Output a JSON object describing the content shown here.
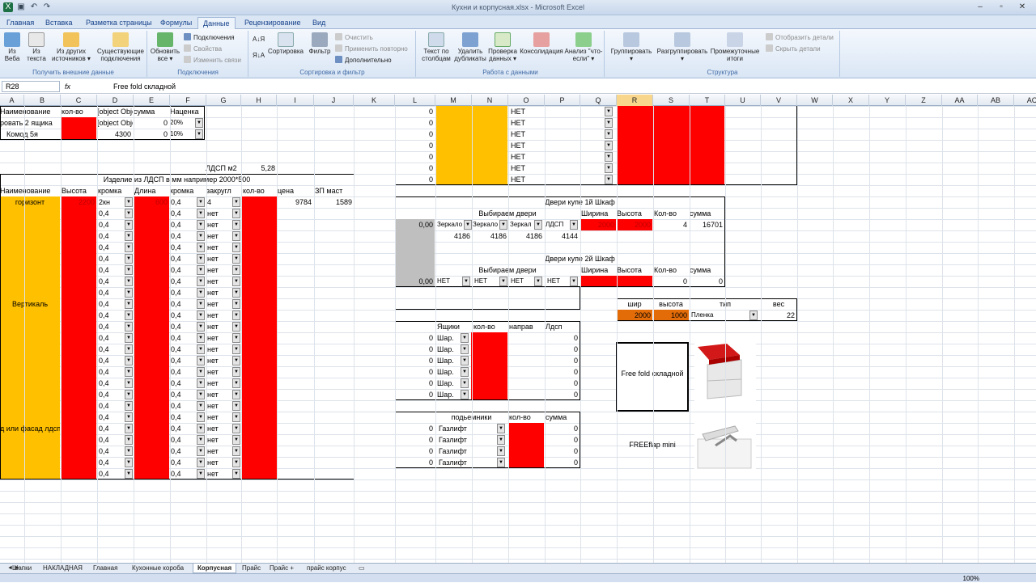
{
  "window": {
    "title": "Кухни и корпусная.xlsx - Microsoft Excel"
  },
  "tabs": [
    "Главная",
    "Вставка",
    "Разметка страницы",
    "Формулы",
    "Данные",
    "Рецензирование",
    "Вид"
  ],
  "ribbon": {
    "g1": {
      "label": "Получить внешние данные",
      "b1": "Из Веба",
      "b2": "Из текста",
      "b3": "Из других источников ▾",
      "b4": "Существующие подключения"
    },
    "g2": {
      "label": "Подключения",
      "b1": "Обновить все ▾",
      "s1": "Подключения",
      "s2": "Свойства",
      "s3": "Изменить связи"
    },
    "g3": {
      "label": "Сортировка и фильтр",
      "b1": "Сортировка",
      "b2": "Фильтр",
      "s1": "Очистить",
      "s2": "Применить повторно",
      "s3": "Дополнительно"
    },
    "g4": {
      "label": "Работа с данными",
      "b1": "Текст по столбцам",
      "b2": "Удалить дубликаты",
      "b3": "Проверка данных ▾",
      "b4": "Консолидация",
      "b5": "Анализ \"что-если\" ▾"
    },
    "g5": {
      "label": "Структура",
      "b1": "Группировать ▾",
      "b2": "Разгруппировать ▾",
      "b3": "Промежуточные итоги",
      "s1": "Отобразить детали",
      "s2": "Скрыть детали"
    }
  },
  "formula": {
    "cell": "R28",
    "fx": "fx",
    "value": "Free fold складной"
  },
  "sheet": {
    "a1": "Наименование",
    "c1": "кол-во",
    "d1": {
      "l": "0,00",
      "m": "Зеркало",
      "n": "Зеркало",
      "o": "Зеркал",
      "p": "ЛДСП",
      "q": "2000",
      "r": "2000",
      "s": "4",
      "t": "16701"
    },
    "e1": "сумма",
    "f1": "Наценка",
    "a2": "ровать 2 ящика",
    "d2": {
      "l": "0,00",
      "m": "НЕТ",
      "n": "НЕТ",
      "o": "НЕТ",
      "p": "НЕТ",
      "s": "0",
      "t": "0"
    },
    "e2": "0",
    "f2": "20%",
    "a3": "Комод 5я",
    "d3": "4300",
    "e3": "0",
    "f3": "10%",
    "g6": "ЛДСП м2",
    "h6": "5,28",
    "t7": "Изделие из ЛДСП в мм например 2000*500",
    "h8": [
      "Наименование",
      "Высота",
      "кромка",
      "Длина",
      "кромка",
      "закругл",
      "кол-во",
      "цена",
      "ЗП маст"
    ],
    "r9": {
      "a": "горизонт",
      "c": "2200",
      "d": "2кн",
      "e": "600",
      "f": "0,4",
      "g": "4",
      "i": "9784",
      "j": "1589"
    },
    "kr": "0,4",
    "zk": "нет",
    "vert": "Вертикаль",
    "fasad": "д или фасад лдсп",
    "net": "НЕТ",
    "doors1": "Двери купе 1й Шкаф",
    "vybir": "Выбираем двери",
    "dh": [
      "Ширина",
      "Высота",
      "Кол-во",
      "сумма"
    ],
    "d1b": [
      "4186",
      "4186",
      "4186",
      "4144"
    ],
    "doors2": "Двери купе 2й Шкаф",
    "w": {
      "h1": "шир",
      "h2": "высота",
      "h3": "тип",
      "h4": "вес",
      "v1": "2000",
      "v2": "1000",
      "v3": "Пленка",
      "v4": "22"
    },
    "yash": [
      "Ящики",
      "кол-во",
      "направ",
      "Лдсп"
    ],
    "shar": "Шар.",
    "pod": [
      "подьемники",
      "кол-во",
      "сумма"
    ],
    "gaz": "Газлифт",
    "card1": "Free fold складной",
    "card2": "FREEflap mini"
  },
  "sheets": [
    "Шапки",
    "НАКЛАДНАЯ",
    "Главная",
    "Кухонные короба",
    "Корпусная",
    "Прайс",
    "Прайс +",
    "прайс корпус"
  ],
  "status": {
    "zoom": "100%"
  },
  "colors": {
    "red": "#ff0000",
    "orange": "#ffc000",
    "dark_orange": "#e36c09"
  }
}
